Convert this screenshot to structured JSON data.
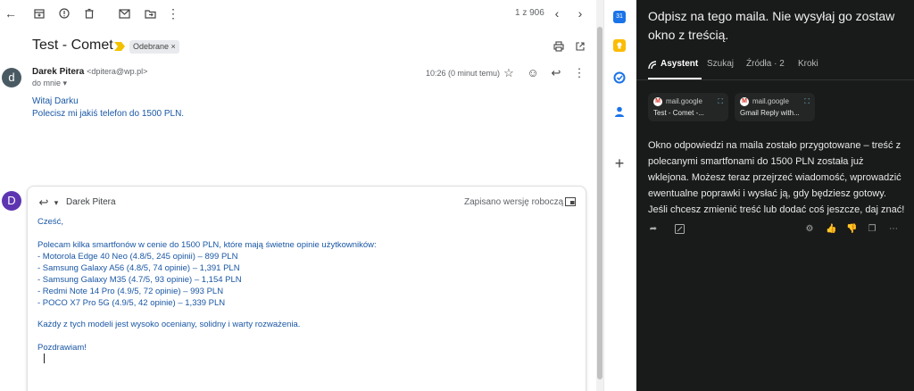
{
  "gmail": {
    "pager": "1 z 906",
    "subject": "Test - Comet",
    "label": "Odebrane ×",
    "message": {
      "avatar_letter": "d",
      "sender_name": "Darek Pitera",
      "sender_email": "<dpitera@wp.pl>",
      "to": "do mnie ▾",
      "time": "10:26 (0 minut temu)",
      "body": [
        "Witaj Darku",
        "Polecisz mi jakiś telefon do 1500 PLN."
      ]
    },
    "reply": {
      "avatar_letter": "D",
      "to": "Darek Pitera",
      "status": "Zapisano wersję roboczą",
      "lines": [
        "Cześć,",
        "",
        "Polecam kilka smartfonów w cenie do 1500 PLN, które mają świetne opinie użytkowników:",
        "- Motorola Edge 40 Neo (4.8/5, 245 opinii) – 899 PLN",
        "- Samsung Galaxy A56 (4.8/5, 74 opinie) – 1,391 PLN",
        "- Samsung Galaxy M35 (4.7/5, 93 opinie) – 1,154 PLN",
        "- Redmi Note 14 Pro (4.9/5, 72 opinie) – 993 PLN",
        "- POCO X7 Pro 5G (4.9/5, 42 opinie) – 1,339 PLN",
        "",
        "Każdy z tych modeli jest wysoko oceniany, solidny i warty rozważenia.",
        "",
        "Pozdrawiam!"
      ]
    }
  },
  "assistant": {
    "prompt": "Odpisz na tego maila. Nie wysyłaj go zostaw okno z treścią.",
    "tabs": [
      "Asystent",
      "Szukaj",
      "Źródła · 2",
      "Kroki"
    ],
    "sources": [
      {
        "site": "mail.google",
        "title": "Test - Comet -..."
      },
      {
        "site": "mail.google",
        "title": "Gmail Reply with..."
      }
    ],
    "answer": "Okno odpowiedzi na maila zostało przygotowane – treść z polecanymi smartfonami do 1500 PLN została już wklejona. Możesz teraz przejrzeć wiadomość, wprowadzić ewentualne poprawki i wysłać ją, gdy będziesz gotowy. Jeśli chcesz zmienić treść lub dodać coś jeszcze, daj znać!"
  },
  "icons": {
    "toolbar": [
      "back-icon",
      "archive-icon",
      "report-spam-icon",
      "delete-icon",
      "mark-unread-icon",
      "move-to-icon",
      "more-icon",
      "prev-icon",
      "next-icon"
    ],
    "strip": [
      "calendar-icon",
      "keep-icon",
      "tasks-icon",
      "contacts-icon",
      "add-icon"
    ]
  },
  "colors": {
    "link_blue": "#1a57a5",
    "assistant_bg": "#191a1a",
    "reply_avatar": "#5e35b1",
    "message_avatar": "#4a5a63"
  }
}
